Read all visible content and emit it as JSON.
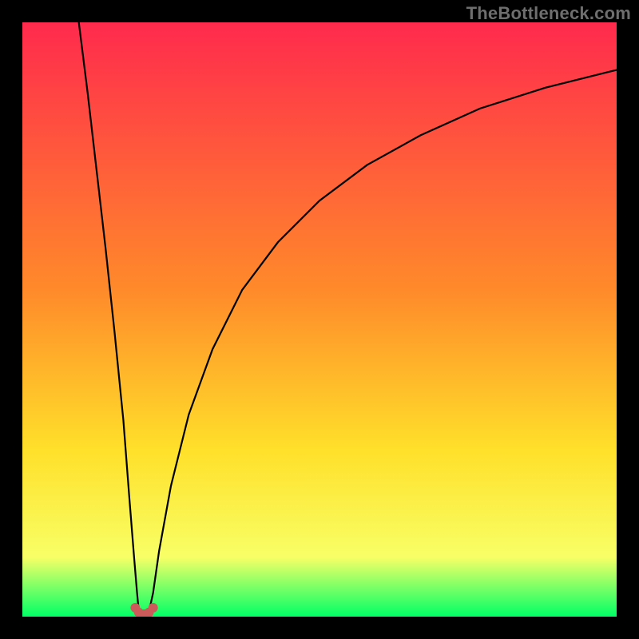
{
  "watermark": "TheBottleneck.com",
  "colors": {
    "gradient_top": "#ff2a4d",
    "gradient_mid1": "#ff8a2a",
    "gradient_mid2": "#ffe02a",
    "gradient_mid3": "#f8ff66",
    "gradient_bottom": "#00ff66",
    "curve": "#000000",
    "dots": "#cc5a5a",
    "frame": "#000000"
  },
  "chart_data": {
    "type": "line",
    "title": "",
    "xlabel": "",
    "ylabel": "",
    "xlim": [
      0,
      100
    ],
    "ylim": [
      0,
      100
    ],
    "series": [
      {
        "name": "left-branch",
        "x": [
          9.5,
          11,
          12.5,
          14,
          15.5,
          17,
          18,
          18.8,
          19.3,
          19.6
        ],
        "values": [
          100,
          88,
          75,
          62,
          48,
          33,
          20,
          10,
          4,
          0.8
        ]
      },
      {
        "name": "right-branch",
        "x": [
          21.3,
          22,
          23,
          25,
          28,
          32,
          37,
          43,
          50,
          58,
          67,
          77,
          88,
          100
        ],
        "values": [
          0.8,
          4,
          11,
          22,
          34,
          45,
          55,
          63,
          70,
          76,
          81,
          85.5,
          89,
          92
        ]
      }
    ],
    "annotations": {
      "valley_dots": [
        {
          "x": 19.0,
          "y": 1.5
        },
        {
          "x": 19.6,
          "y": 0.7
        },
        {
          "x": 20.5,
          "y": 0.4
        },
        {
          "x": 21.3,
          "y": 0.7
        },
        {
          "x": 22.0,
          "y": 1.5
        }
      ]
    }
  }
}
